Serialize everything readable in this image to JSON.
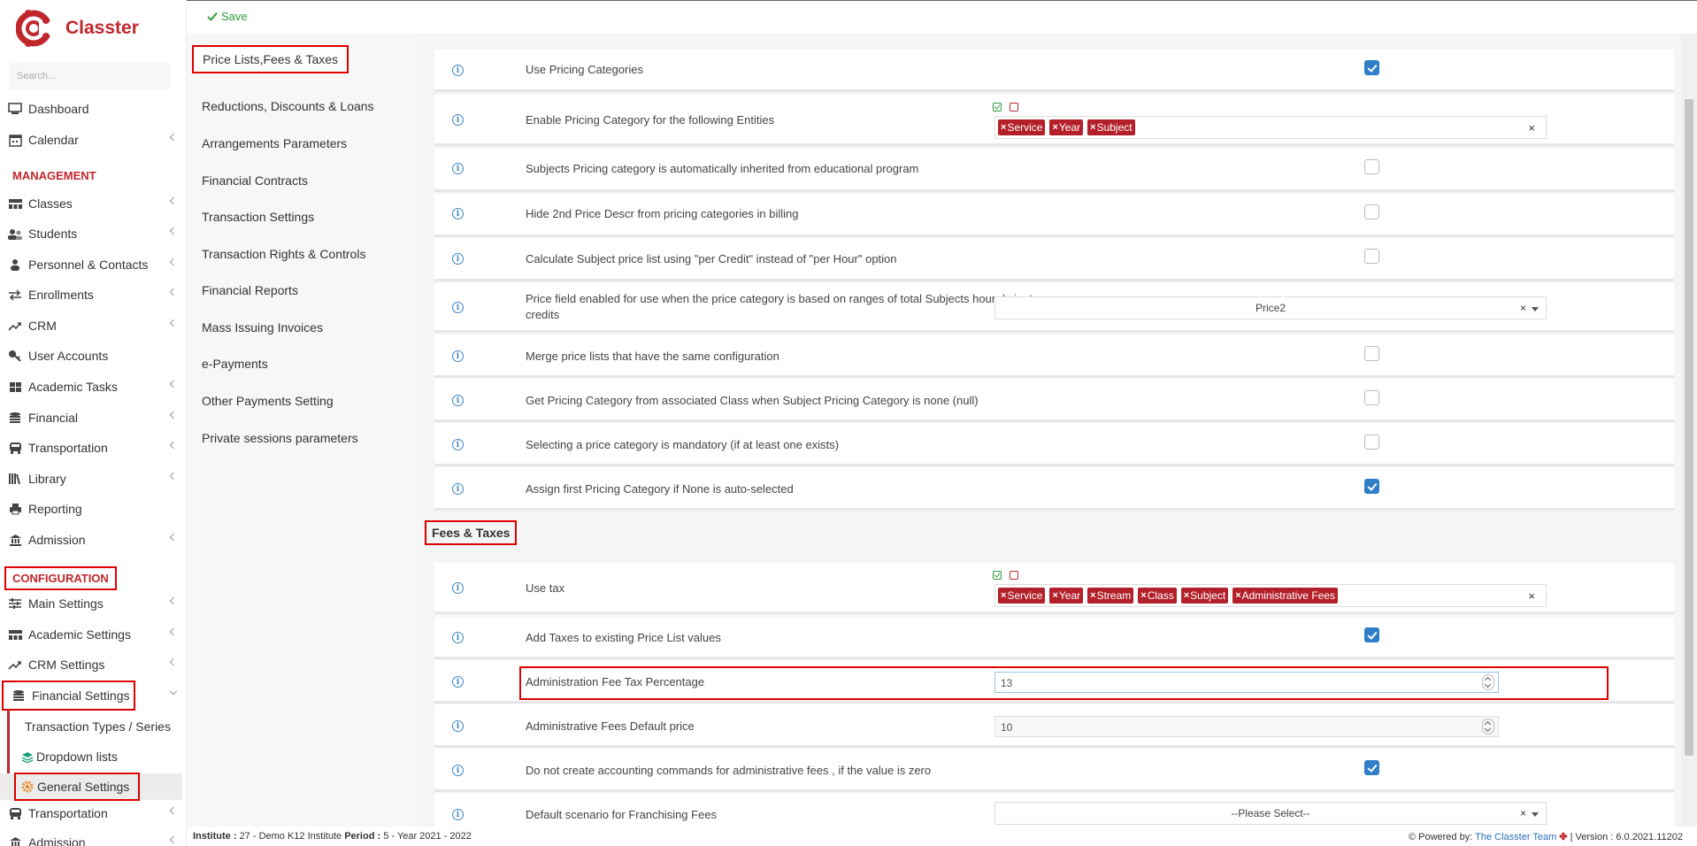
{
  "brand": {
    "name": "Classter",
    "color": "#c0272d"
  },
  "search": {
    "placeholder": "Search..."
  },
  "sidebar": {
    "items": [
      {
        "label": "Dashboard",
        "icon": "monitor-icon"
      },
      {
        "label": "Calendar",
        "icon": "calendar-icon"
      }
    ],
    "management_header": "MANAGEMENT",
    "management": [
      {
        "label": "Classes",
        "icon": "classes-icon"
      },
      {
        "label": "Students",
        "icon": "students-icon"
      },
      {
        "label": "Personnel & Contacts",
        "icon": "person-icon"
      },
      {
        "label": "Enrollments",
        "icon": "exchange-icon"
      },
      {
        "label": "CRM",
        "icon": "crm-icon"
      },
      {
        "label": "User Accounts",
        "icon": "key-icon"
      },
      {
        "label": "Academic Tasks",
        "icon": "grid-icon"
      },
      {
        "label": "Financial",
        "icon": "coins-icon"
      },
      {
        "label": "Transportation",
        "icon": "bus-icon"
      },
      {
        "label": "Library",
        "icon": "books-icon"
      },
      {
        "label": "Reporting",
        "icon": "printer-icon"
      },
      {
        "label": "Admission",
        "icon": "bank-icon"
      }
    ],
    "configuration_header": "CONFIGURATION",
    "configuration": [
      {
        "label": "Main Settings",
        "icon": "sliders-icon"
      },
      {
        "label": "Academic Settings",
        "icon": "classes-icon"
      },
      {
        "label": "CRM Settings",
        "icon": "crm-icon"
      },
      {
        "label": "Financial Settings",
        "icon": "coins-icon"
      }
    ],
    "financial_sub": [
      {
        "label": "Transaction Types / Series"
      },
      {
        "label": "Dropdown lists",
        "icon": "layers-icon"
      },
      {
        "label": "General Settings",
        "icon": "gear-icon"
      }
    ],
    "after": [
      {
        "label": "Transportation",
        "icon": "bus-icon"
      },
      {
        "label": "Admission",
        "icon": "bank-icon"
      }
    ]
  },
  "toolbar": {
    "save_label": "Save"
  },
  "settings_menu": [
    "Price Lists,Fees & Taxes",
    "Reductions, Discounts & Loans",
    "Arrangements Parameters",
    "Financial Contracts",
    "Transaction Settings",
    "Transaction Rights & Controls",
    "Financial Reports",
    "Mass Issuing Invoices",
    "e-Payments",
    "Other Payments Setting",
    "Private sessions parameters"
  ],
  "pricing_rows": {
    "use_pricing_categories": {
      "label": "Use Pricing Categories",
      "checked": true
    },
    "enable_pricing_category": {
      "label": "Enable Pricing Category for the following Entities",
      "tags": [
        "Service",
        "Year",
        "Subject"
      ]
    },
    "subjects_inherited": {
      "label": "Subjects Pricing category is automatically inherited from educational program",
      "checked": false
    },
    "hide_2nd_price": {
      "label": "Hide 2nd Price Descr from pricing categories in billing",
      "checked": false
    },
    "per_credit": {
      "label": "Calculate Subject price list using \"per Credit\" instead of \"per Hour\" option",
      "checked": false
    },
    "price_field": {
      "label_line1": "Price field enabled for use when the price category is based on ranges of total Subjects hours/minutes or",
      "label_line2": "credits",
      "value": "Price2"
    },
    "merge_price_lists": {
      "label": "Merge price lists that have the same configuration",
      "checked": false
    },
    "get_from_class": {
      "label": "Get Pricing Category from associated Class when Subject Pricing Category is none (null)",
      "checked": false
    },
    "mandatory": {
      "label": "Selecting a price category is mandatory (if at least one exists)",
      "checked": false
    },
    "assign_first": {
      "label": "Assign first Pricing Category if None is auto-selected",
      "checked": true
    }
  },
  "fees_section": {
    "title": "Fees & Taxes",
    "use_tax": {
      "label": "Use tax",
      "tags": [
        "Service",
        "Year",
        "Stream",
        "Class",
        "Subject",
        "Administrative Fees"
      ]
    },
    "add_taxes": {
      "label": "Add Taxes to existing Price List values",
      "checked": true
    },
    "admin_fee_tax": {
      "label": "Administration Fee Tax Percentage",
      "value": "13"
    },
    "admin_fee_default": {
      "label": "Administrative Fees Default price",
      "value": "10"
    },
    "no_accounting": {
      "label": "Do not create accounting commands for administrative fees , if the value is zero",
      "checked": true
    },
    "franchising": {
      "label": "Default scenario for Franchising Fees",
      "value": "--Please Select--"
    }
  },
  "footer": {
    "institute_label": "Institute :",
    "institute_value": "27 - Demo K12 Institute",
    "period_label": "Period :",
    "period_value": "5 - Year 2021 - 2022",
    "powered_label": "Powered by:",
    "powered_link": "The Classter Team",
    "version": "| Version : 6.0.2021.11202"
  },
  "colors": {
    "accent_red": "#c0272d",
    "highlight": "#e00000",
    "checkbox_blue": "#2f7ec8",
    "tag_red": "#b3202a",
    "save_green": "#2a9d3a"
  }
}
